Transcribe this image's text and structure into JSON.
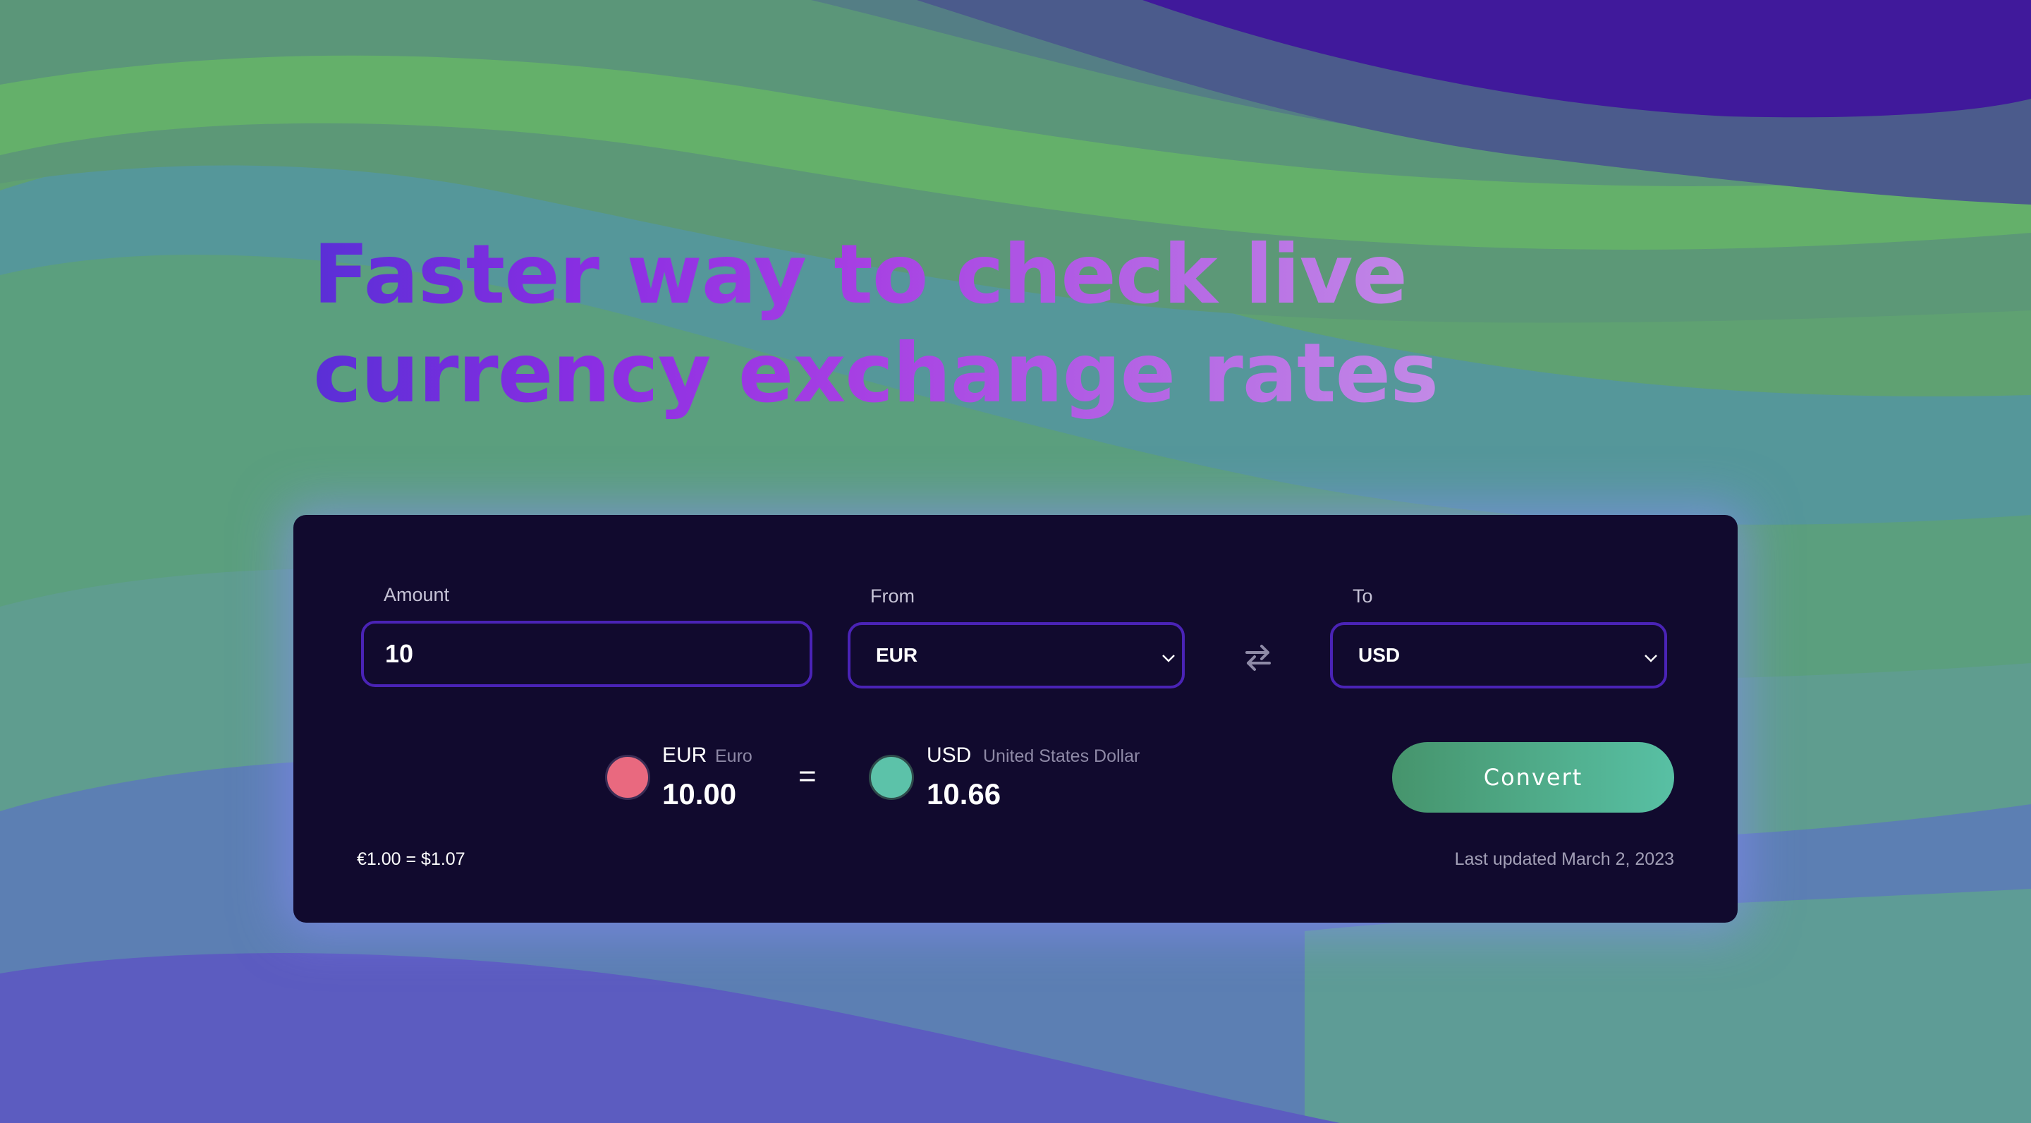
{
  "hero": {
    "headline_line1": "Faster way to check live",
    "headline_line2": "currency exchange rates"
  },
  "converter": {
    "amount": {
      "label": "Amount",
      "value": "10"
    },
    "from": {
      "label": "From",
      "selected": "EUR"
    },
    "to": {
      "label": "To",
      "selected": "USD"
    },
    "swap_icon": "swap-arrows-icon",
    "result": {
      "from": {
        "code": "EUR",
        "name": "Euro",
        "amount": "10.00",
        "color": "#e9697f"
      },
      "equals": "=",
      "to": {
        "code": "USD",
        "name": "United States Dollar",
        "amount": "10.66",
        "color": "#5cc2a9"
      }
    },
    "convert_label": "Convert",
    "rate_text": "€1.00 = $1.07",
    "last_updated": "Last updated March 2, 2023"
  },
  "colors": {
    "card_background": "#110a2e",
    "input_border": "#4a23b6",
    "button_gradient_start": "#46946c",
    "button_gradient_end": "#58c0a4",
    "headline_gradient": [
      "#5a2fd6",
      "#8b2ee3",
      "#c28ae6"
    ]
  }
}
